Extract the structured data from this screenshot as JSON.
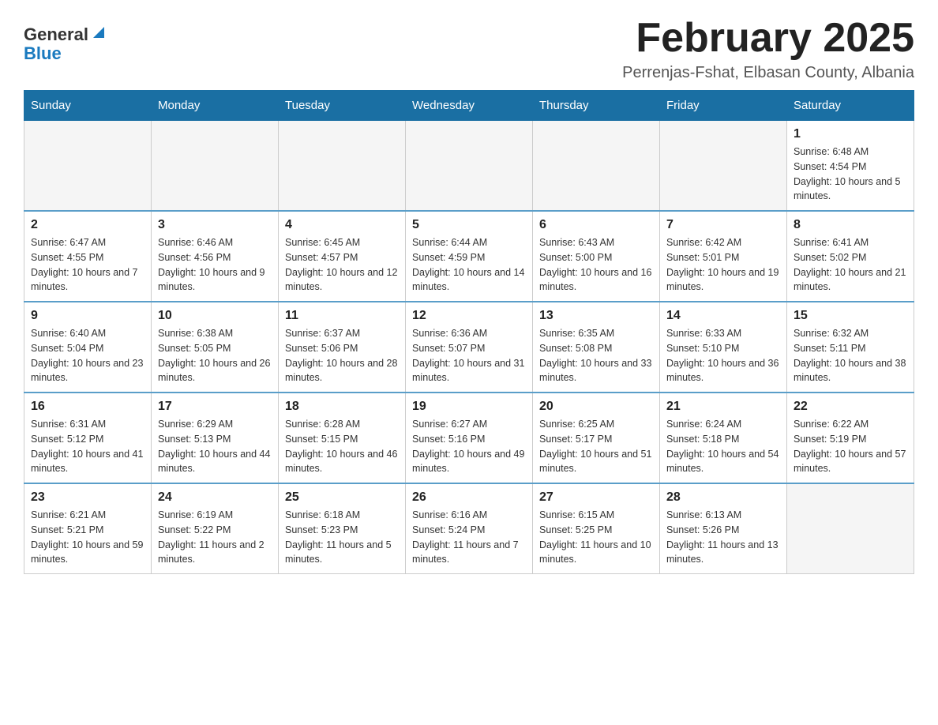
{
  "logo": {
    "general": "General",
    "blue": "Blue"
  },
  "header": {
    "month_year": "February 2025",
    "location": "Perrenjas-Fshat, Elbasan County, Albania"
  },
  "days_of_week": [
    "Sunday",
    "Monday",
    "Tuesday",
    "Wednesday",
    "Thursday",
    "Friday",
    "Saturday"
  ],
  "weeks": [
    [
      {
        "day": "",
        "info": ""
      },
      {
        "day": "",
        "info": ""
      },
      {
        "day": "",
        "info": ""
      },
      {
        "day": "",
        "info": ""
      },
      {
        "day": "",
        "info": ""
      },
      {
        "day": "",
        "info": ""
      },
      {
        "day": "1",
        "info": "Sunrise: 6:48 AM\nSunset: 4:54 PM\nDaylight: 10 hours and 5 minutes."
      }
    ],
    [
      {
        "day": "2",
        "info": "Sunrise: 6:47 AM\nSunset: 4:55 PM\nDaylight: 10 hours and 7 minutes."
      },
      {
        "day": "3",
        "info": "Sunrise: 6:46 AM\nSunset: 4:56 PM\nDaylight: 10 hours and 9 minutes."
      },
      {
        "day": "4",
        "info": "Sunrise: 6:45 AM\nSunset: 4:57 PM\nDaylight: 10 hours and 12 minutes."
      },
      {
        "day": "5",
        "info": "Sunrise: 6:44 AM\nSunset: 4:59 PM\nDaylight: 10 hours and 14 minutes."
      },
      {
        "day": "6",
        "info": "Sunrise: 6:43 AM\nSunset: 5:00 PM\nDaylight: 10 hours and 16 minutes."
      },
      {
        "day": "7",
        "info": "Sunrise: 6:42 AM\nSunset: 5:01 PM\nDaylight: 10 hours and 19 minutes."
      },
      {
        "day": "8",
        "info": "Sunrise: 6:41 AM\nSunset: 5:02 PM\nDaylight: 10 hours and 21 minutes."
      }
    ],
    [
      {
        "day": "9",
        "info": "Sunrise: 6:40 AM\nSunset: 5:04 PM\nDaylight: 10 hours and 23 minutes."
      },
      {
        "day": "10",
        "info": "Sunrise: 6:38 AM\nSunset: 5:05 PM\nDaylight: 10 hours and 26 minutes."
      },
      {
        "day": "11",
        "info": "Sunrise: 6:37 AM\nSunset: 5:06 PM\nDaylight: 10 hours and 28 minutes."
      },
      {
        "day": "12",
        "info": "Sunrise: 6:36 AM\nSunset: 5:07 PM\nDaylight: 10 hours and 31 minutes."
      },
      {
        "day": "13",
        "info": "Sunrise: 6:35 AM\nSunset: 5:08 PM\nDaylight: 10 hours and 33 minutes."
      },
      {
        "day": "14",
        "info": "Sunrise: 6:33 AM\nSunset: 5:10 PM\nDaylight: 10 hours and 36 minutes."
      },
      {
        "day": "15",
        "info": "Sunrise: 6:32 AM\nSunset: 5:11 PM\nDaylight: 10 hours and 38 minutes."
      }
    ],
    [
      {
        "day": "16",
        "info": "Sunrise: 6:31 AM\nSunset: 5:12 PM\nDaylight: 10 hours and 41 minutes."
      },
      {
        "day": "17",
        "info": "Sunrise: 6:29 AM\nSunset: 5:13 PM\nDaylight: 10 hours and 44 minutes."
      },
      {
        "day": "18",
        "info": "Sunrise: 6:28 AM\nSunset: 5:15 PM\nDaylight: 10 hours and 46 minutes."
      },
      {
        "day": "19",
        "info": "Sunrise: 6:27 AM\nSunset: 5:16 PM\nDaylight: 10 hours and 49 minutes."
      },
      {
        "day": "20",
        "info": "Sunrise: 6:25 AM\nSunset: 5:17 PM\nDaylight: 10 hours and 51 minutes."
      },
      {
        "day": "21",
        "info": "Sunrise: 6:24 AM\nSunset: 5:18 PM\nDaylight: 10 hours and 54 minutes."
      },
      {
        "day": "22",
        "info": "Sunrise: 6:22 AM\nSunset: 5:19 PM\nDaylight: 10 hours and 57 minutes."
      }
    ],
    [
      {
        "day": "23",
        "info": "Sunrise: 6:21 AM\nSunset: 5:21 PM\nDaylight: 10 hours and 59 minutes."
      },
      {
        "day": "24",
        "info": "Sunrise: 6:19 AM\nSunset: 5:22 PM\nDaylight: 11 hours and 2 minutes."
      },
      {
        "day": "25",
        "info": "Sunrise: 6:18 AM\nSunset: 5:23 PM\nDaylight: 11 hours and 5 minutes."
      },
      {
        "day": "26",
        "info": "Sunrise: 6:16 AM\nSunset: 5:24 PM\nDaylight: 11 hours and 7 minutes."
      },
      {
        "day": "27",
        "info": "Sunrise: 6:15 AM\nSunset: 5:25 PM\nDaylight: 11 hours and 10 minutes."
      },
      {
        "day": "28",
        "info": "Sunrise: 6:13 AM\nSunset: 5:26 PM\nDaylight: 11 hours and 13 minutes."
      },
      {
        "day": "",
        "info": ""
      }
    ]
  ]
}
